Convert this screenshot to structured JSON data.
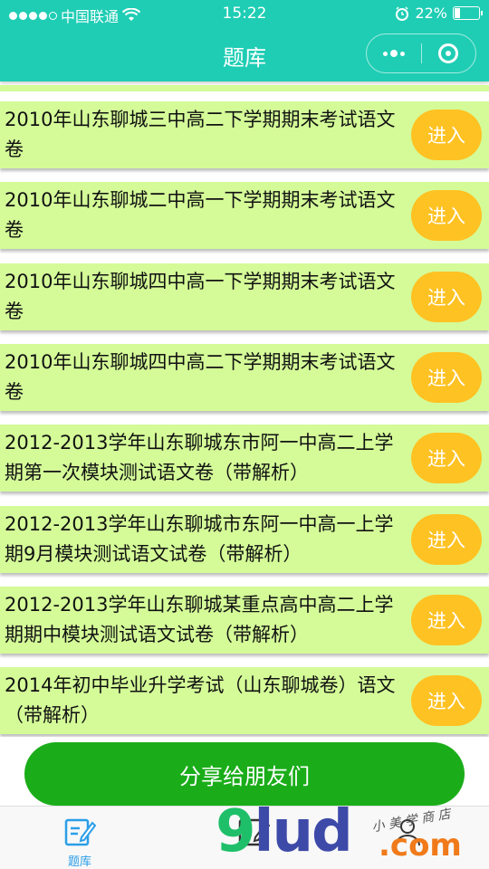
{
  "status_bar": {
    "carrier": "中国联通",
    "time": "15:22",
    "battery": "22%",
    "battery_level": 0.22
  },
  "nav": {
    "title": "题库"
  },
  "list": {
    "items": [
      {
        "title": "2010年山东聊城三中高二下学期期末考试语文卷",
        "button": "进入"
      },
      {
        "title": "2010年山东聊城二中高一下学期期末考试语文卷",
        "button": "进入"
      },
      {
        "title": "2010年山东聊城四中高一下学期期末考试语文卷",
        "button": "进入"
      },
      {
        "title": "2010年山东聊城四中高二下学期期末考试语文卷",
        "button": "进入"
      },
      {
        "title": "2012-2013学年山东聊城东市阿一中高二上学期第一次模块测试语文卷（带解析）",
        "button": "进入"
      },
      {
        "title": "2012-2013学年山东聊城市东阿一中高一上学期9月模块测试语文试卷（带解析）",
        "button": "进入"
      },
      {
        "title": "2012-2013学年山东聊城某重点高中高二上学期期中模块测试语文试卷（带解析）",
        "button": "进入"
      },
      {
        "title": "2014年初中毕业升学考试（山东聊城卷）语文（带解析）",
        "button": "进入"
      }
    ]
  },
  "share_button": "分享给朋友们",
  "tabbar": {
    "tabs": [
      {
        "label": "题库",
        "active": true
      }
    ]
  },
  "watermark": {
    "main": "9lud",
    "small": "小 美 学 商 店",
    "suffix": ".com"
  },
  "colors": {
    "header": "#1fcdb4",
    "item_bg": "#d4fb98",
    "enter_button": "#ffc223",
    "share_button": "#1aad19",
    "tab_active": "#2a9ee8"
  }
}
